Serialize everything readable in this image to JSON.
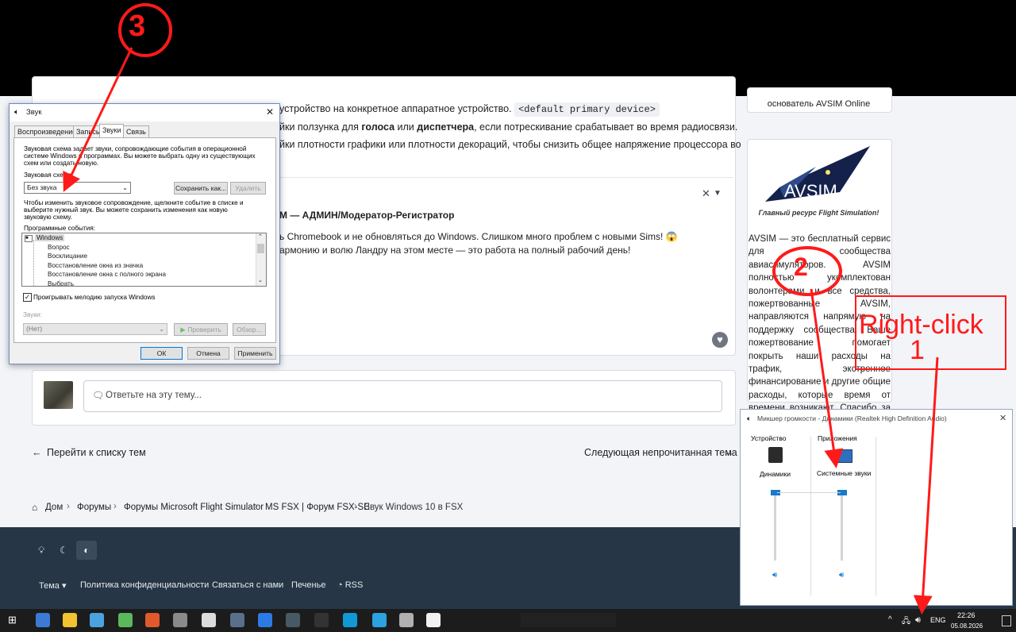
{
  "forum": {
    "line1_text": "устройство на конкретное аппаратное устройство.",
    "line1_code": "<default primary device>",
    "line2_pre": "йки ползунка для ",
    "line2_b1": "голоса",
    "line2_mid": " или ",
    "line2_b2": "диспетчера",
    "line2_post": ", если потрескивание срабатывает во время радиосвязи.",
    "line3": "йки плотности графики или плотности декораций, чтобы снизить общее напряжение процессора во",
    "line4": "",
    "author": "М — АДМИН/Модератор-Регистратор",
    "post1": "ь Chromebook и не обновляться до Windows. Слишком много проблем с новыми Sims! 😱",
    "post2": "армонию и волю Ландру на этом месте — это работа на полный рабочий день!",
    "reply_placeholder": "Ответьте на эту тему...",
    "nav_prev": "Перейти к списку тем",
    "nav_next": "Следующая непрочитанная тема",
    "breadcrumbs": [
      "Дом",
      "Форумы",
      "Форумы Microsoft Flight Simulator",
      "MS FSX | Форум FSX-SE",
      "Звук Windows 10 в FSX"
    ]
  },
  "sidebar": {
    "founder": "основатель AVSIM Online",
    "logo_text": "AVSIM",
    "tagline": "Главный ресурс Flight Simulation!",
    "donate_text": "AVSIM — это бесплатный сервис для сообщества авиасимуляторов. AVSIM полностью укомплектован волонтерами, и все средства, пожертвованные AVSIM, направляются напрямую на поддержку сообщества. Ваше пожертвование помогает покрыть наши расходы на трафик, экстренное финансирование и другие общие расходы, которые время от времени возникают. Спасибо за вашу поддержку!"
  },
  "footer": {
    "links": [
      "Тема",
      "Политика конфиденциальности",
      "Связаться с нами",
      "Печенье",
      "RSS"
    ]
  },
  "sound_dialog": {
    "title": "Звук",
    "tabs": [
      "Воспроизведение",
      "Запись",
      "Звуки",
      "Связь"
    ],
    "desc": [
      "Звуковая схема задает звуки, сопровождающие события в операционной",
      "системе Windows и программах. Вы можете выбрать одну из существующих",
      "схем или создать новую."
    ],
    "scheme_label": "Звуковая схема:",
    "scheme_value": "Без звука",
    "save_as": "Сохранить как...",
    "delete": "Удалить",
    "hint": [
      "Чтобы изменить звуковое сопровождение, щелкните событие в списке и",
      "выберите нужный звук. Вы можете сохранить изменения как новую",
      "звуковую схему."
    ],
    "events_label": "Программные события:",
    "events": [
      "Windows",
      "Вопрос",
      "Восклицание",
      "Восстановление окна из значка",
      "Восстановление окна с полного экрана",
      "Выбрать"
    ],
    "startup_checkbox": "Проигрывать мелодию запуска Windows",
    "sounds_label": "Звуки:",
    "sound_value": "(Нет)",
    "test": "Проверить",
    "browse": "Обзор...",
    "ok": "ОК",
    "cancel": "Отмена",
    "apply": "Применить"
  },
  "mixer": {
    "title": "Микшер громкости - Динамики (Realtek High Definition Audio)",
    "device_header": "Устройство",
    "apps_header": "Приложения",
    "device_name": "Динамики",
    "app_name": "Системные звуки",
    "device_level": 1.0,
    "app_level": 1.0
  },
  "taskbar": {
    "lang": "ENG",
    "time": "22:26",
    "date": "05.08.2026",
    "icons": [
      "calculator-icon",
      "folder-icon",
      "qb-icon",
      "torrent-icon",
      "p-icon",
      "tank-icon",
      "plane-icon",
      "fighter-icon",
      "globe-icon",
      "as-icon",
      "p3d-icon",
      "edge-icon",
      "telegram-icon",
      "dj-icon",
      "fsx-icon"
    ]
  },
  "annotations": {
    "n1": "1",
    "n2": "2",
    "n3": "3",
    "right_click": "Right-click"
  },
  "colors": {
    "annotation": "#ff1a1a",
    "footer_bg": "#263646",
    "win_accent": "#0078d7"
  }
}
